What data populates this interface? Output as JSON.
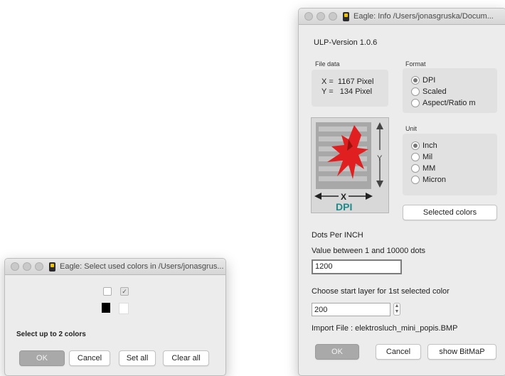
{
  "info_window": {
    "title": "Eagle: Info /Users/jonasgruska/Docum...",
    "ulp_version": "ULP-Version 1.0.6",
    "file_data": {
      "label": "File data",
      "x_line": "X =  1167 Pixel",
      "y_line": "Y =   134 Pixel"
    },
    "format": {
      "label": "Format",
      "options": [
        "DPI",
        "Scaled",
        "Aspect/Ratio m"
      ],
      "selected": "DPI"
    },
    "unit": {
      "label": "Unit",
      "options": [
        "Inch",
        "Mil",
        "MM",
        "Micron"
      ],
      "selected": "Inch"
    },
    "preview": {
      "x_label": "X",
      "y_label": "Y",
      "mode_label": "DPI"
    },
    "selected_colors_button": "Selected colors",
    "dots_per_heading": "Dots Per INCH",
    "value_range_text": "Value between 1 and 10000 dots",
    "dpi_value": "1200",
    "start_layer_label": "Choose start layer for 1st selected color",
    "start_layer_value": "200",
    "import_file_text": "Import File : elektrosluch_mini_popis.BMP",
    "ok_button": "OK",
    "cancel_button": "Cancel",
    "show_bitmap_button": "show BitMaP"
  },
  "colors_window": {
    "title": "Eagle: Select used colors in /Users/jonasgrus...",
    "checkboxes": [
      {
        "checked": false
      },
      {
        "checked": true
      }
    ],
    "swatch_colors": [
      "#000000",
      "#ffffff"
    ],
    "instruction": "Select up to 2 colors",
    "ok_button": "OK",
    "cancel_button": "Cancel",
    "set_all_button": "Set all",
    "clear_all_button": "Clear all"
  },
  "colors": {
    "accent_teal": "#1c8a8a",
    "logo_red": "#e02020"
  },
  "icons": {
    "checkmark": "✓",
    "stepper_up": "▲",
    "stepper_down": "▼"
  }
}
